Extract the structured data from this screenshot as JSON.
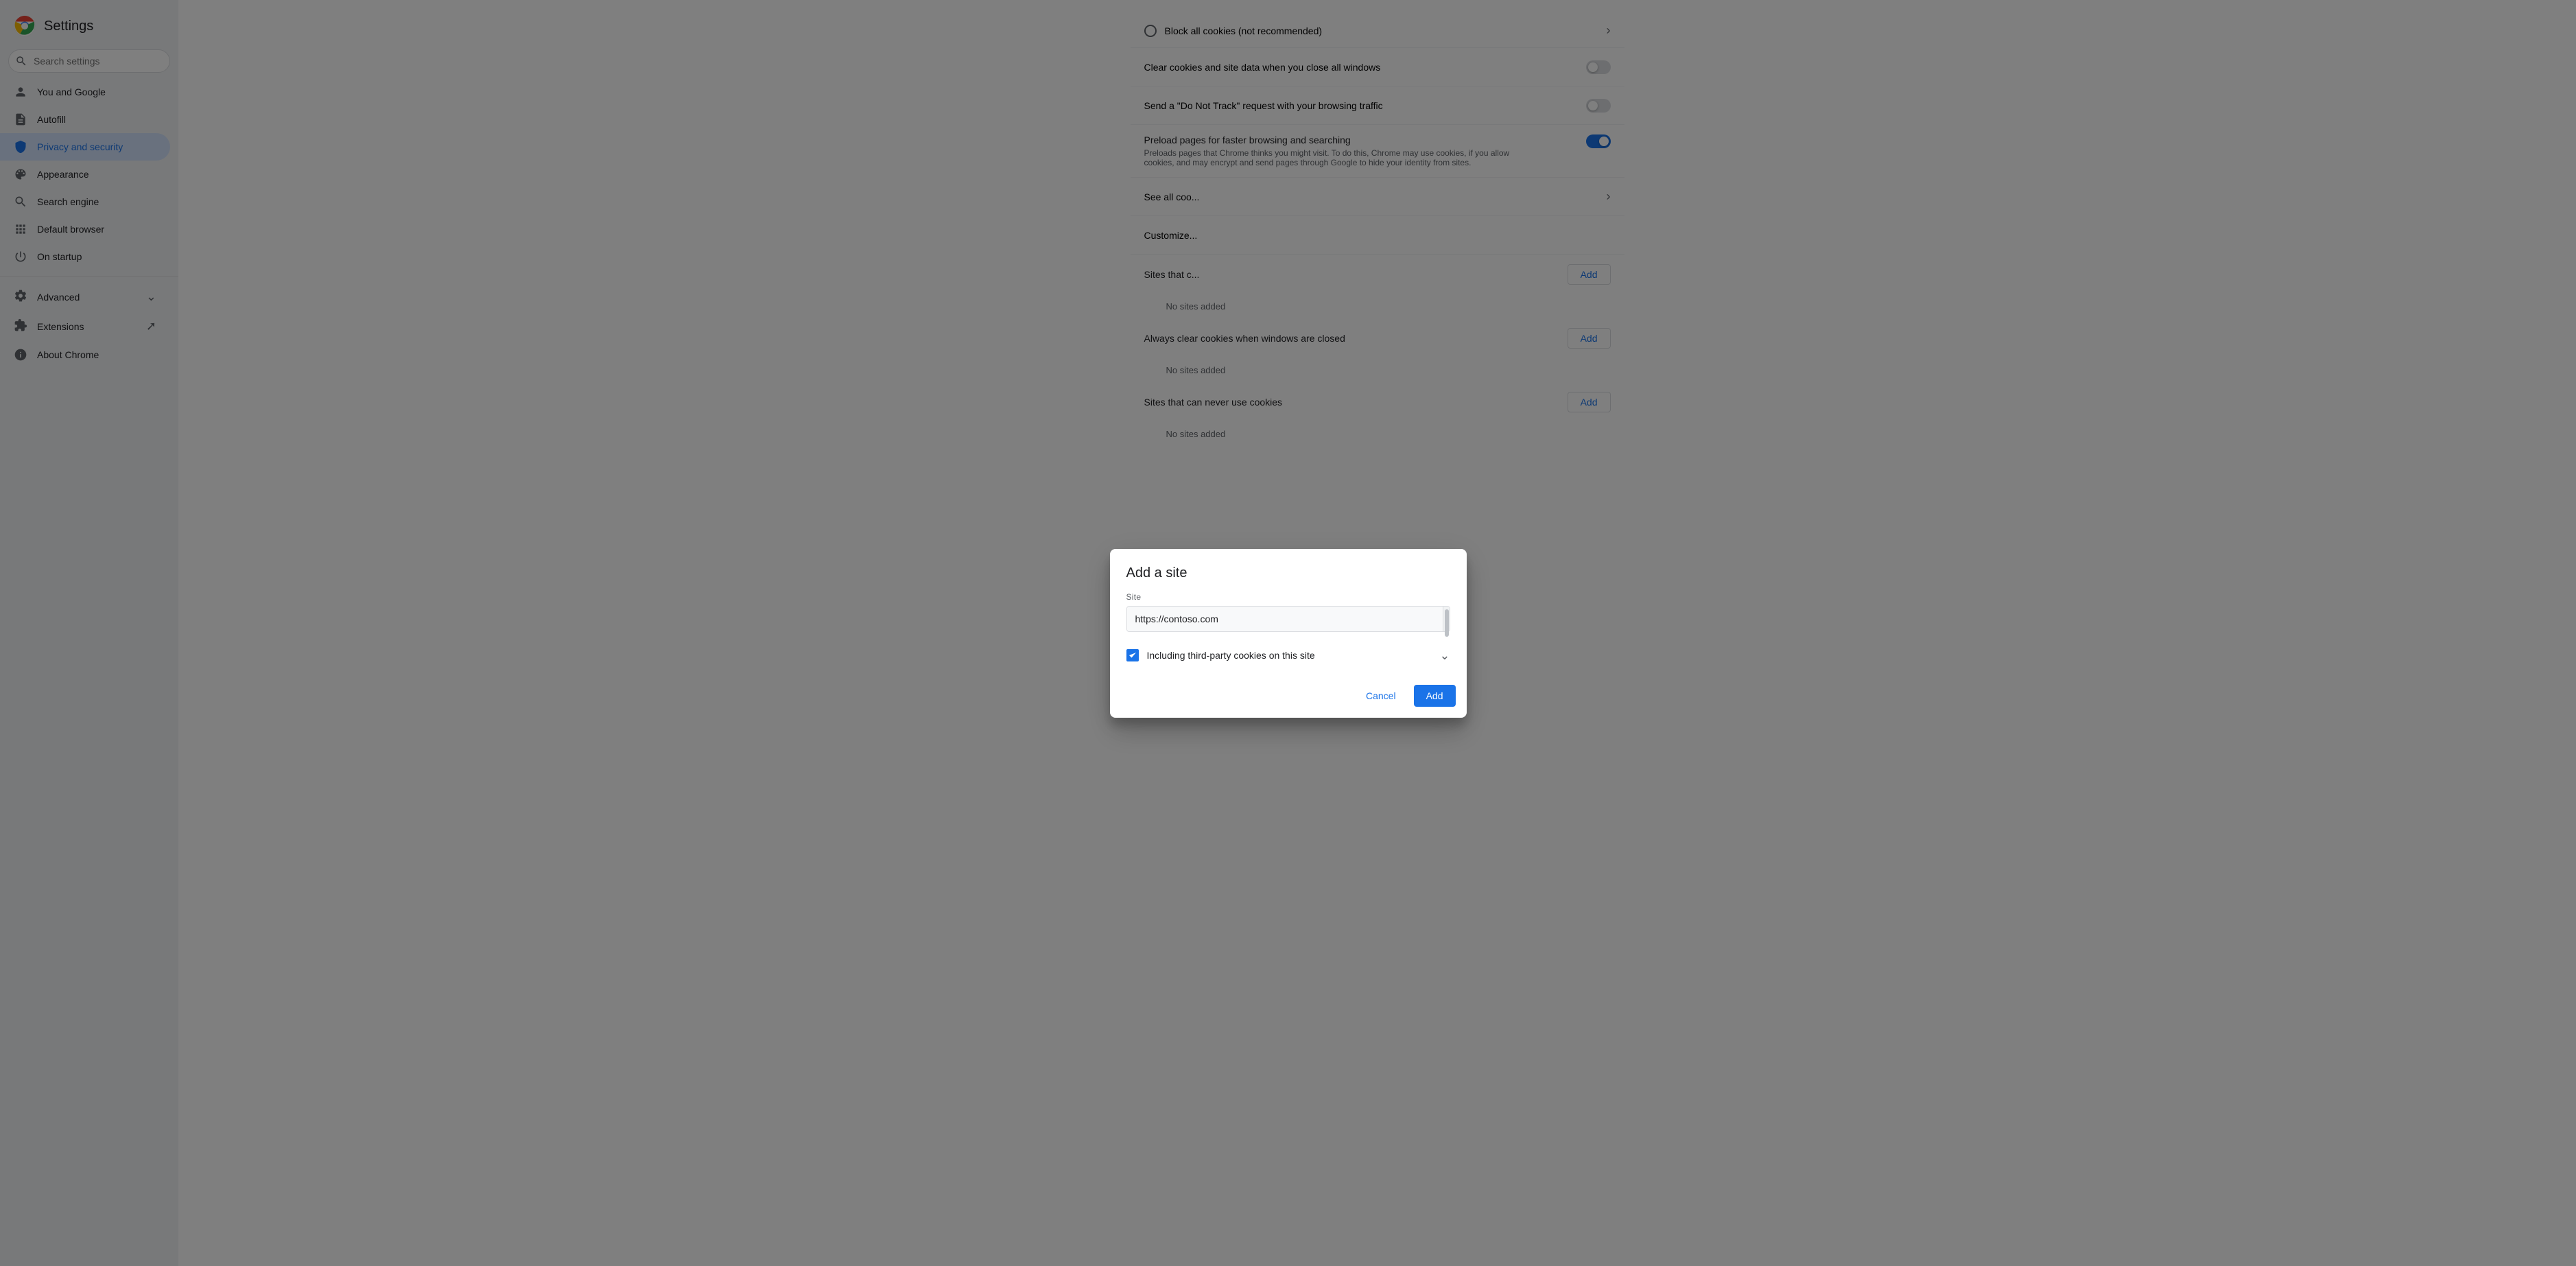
{
  "sidebar": {
    "title": "Settings",
    "search_placeholder": "Search settings",
    "items": [
      {
        "id": "you-and-google",
        "label": "You and Google",
        "icon": "person"
      },
      {
        "id": "autofill",
        "label": "Autofill",
        "icon": "autofill"
      },
      {
        "id": "privacy-and-security",
        "label": "Privacy and security",
        "icon": "shield",
        "active": true
      },
      {
        "id": "appearance",
        "label": "Appearance",
        "icon": "appearance"
      },
      {
        "id": "search-engine",
        "label": "Search engine",
        "icon": "search"
      },
      {
        "id": "default-browser",
        "label": "Default browser",
        "icon": "browser"
      },
      {
        "id": "on-startup",
        "label": "On startup",
        "icon": "startup"
      }
    ],
    "advanced_label": "Advanced",
    "extensions_label": "Extensions",
    "about_chrome_label": "About Chrome"
  },
  "main": {
    "block_all_cookies_label": "Block all cookies (not recommended)",
    "clear_cookies_label": "Clear cookies and site data when you close all windows",
    "clear_cookies_toggle": false,
    "dnt_label": "Send a \"Do Not Track\" request with your browsing traffic",
    "dnt_toggle": false,
    "preload_title": "Preload pages for faster browsing and searching",
    "preload_sub": "Preloads pages that Chrome thinks you might visit. To do this, Chrome may use cookies, if you allow cookies, and may encrypt and send pages through Google to hide your identity from sites.",
    "preload_toggle": true,
    "see_all_cookies_label": "See all coo...",
    "customize_label": "Customize...",
    "sites_can_always_label": "Sites that c...",
    "no_sites_added_1": "No sites added",
    "always_clear_label": "Always clear cookies when windows are closed",
    "no_sites_added_2": "No sites added",
    "sites_never_label": "Sites that can never use cookies",
    "no_sites_added_3": "No sites added",
    "add_btn_1": "Add",
    "add_btn_2": "Add",
    "add_btn_3": "Add"
  },
  "dialog": {
    "title": "Add a site",
    "site_label": "Site",
    "site_input_value": "https://contoso.com",
    "checkbox_label": "Including third-party cookies on this site",
    "checkbox_checked": true,
    "cancel_label": "Cancel",
    "add_label": "Add"
  }
}
